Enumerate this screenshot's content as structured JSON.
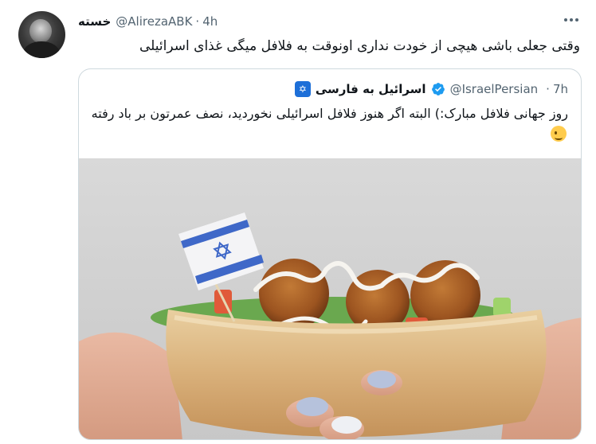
{
  "tweet": {
    "author_name": "خسته",
    "author_handle": "@AlirezaABK",
    "separator": "·",
    "time": "4h",
    "text": "وقتی جعلی باشی هیچی از خودت نداری اونوقت به فلافل میگی غذای اسرائیلی"
  },
  "quote": {
    "author_name": "اسرائیل به فارسی",
    "author_handle": "@IsraelPersian",
    "separator": "·",
    "time": "7h",
    "text": "روز جهانی فلافل مبارک:) البته اگر هنوز فلافل اسرائیلی نخوردید، نصف عمرتون بر باد رفته",
    "media_description": "falafel-pita-with-israeli-flag"
  },
  "icons": {
    "more": "more-options-icon",
    "verified": "verified-badge-icon",
    "winking": "winking-face-emoji"
  },
  "colors": {
    "text_primary": "#0f1419",
    "text_secondary": "#536471",
    "border": "#cfd9de",
    "verified_blue": "#1d9bf0",
    "flag_blue": "#3f68c8"
  }
}
